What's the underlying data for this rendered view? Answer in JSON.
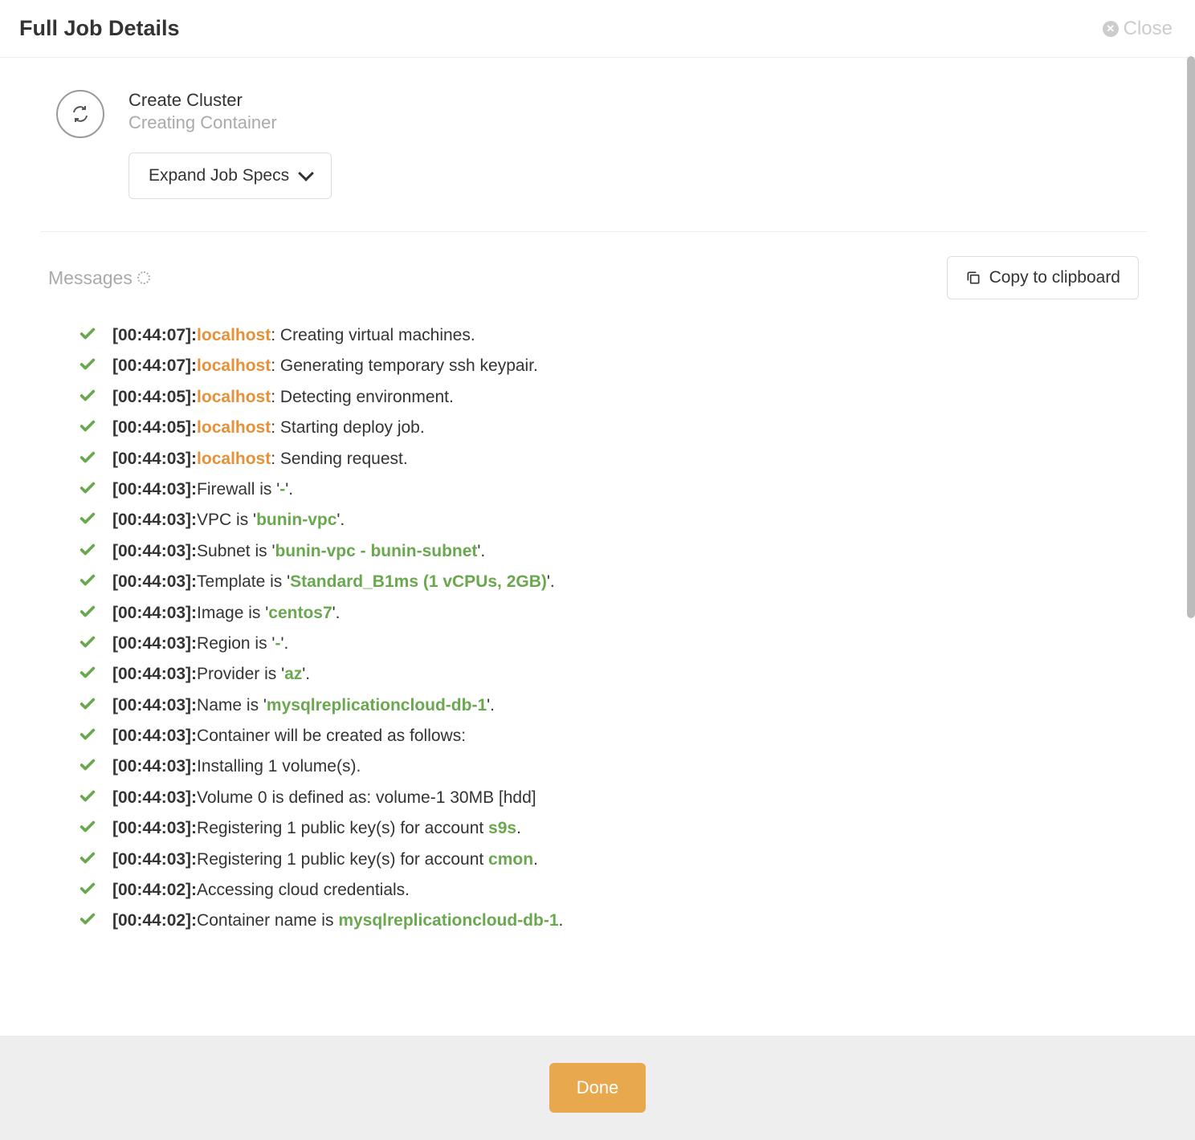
{
  "header": {
    "title": "Full Job Details",
    "close_label": "Close"
  },
  "job": {
    "name": "Create Cluster",
    "status": "Creating Container",
    "expand_label": "Expand Job Specs"
  },
  "messages_section": {
    "label": "Messages",
    "copy_label": "Copy to clipboard"
  },
  "footer": {
    "done_label": "Done"
  },
  "logs": [
    {
      "ts": "[00:44:07]:",
      "host": "localhost",
      "pre": ": ",
      "text": "Creating virtual machines."
    },
    {
      "ts": "[00:44:07]:",
      "host": "localhost",
      "pre": ": ",
      "text": "Generating temporary ssh keypair."
    },
    {
      "ts": "[00:44:05]:",
      "host": "localhost",
      "pre": ": ",
      "text": "Detecting environment."
    },
    {
      "ts": "[00:44:05]:",
      "host": "localhost",
      "pre": ": ",
      "text": "Starting deploy job."
    },
    {
      "ts": "[00:44:03]:",
      "host": "localhost",
      "pre": ": ",
      "text": "Sending request."
    },
    {
      "ts": "[00:44:03]:",
      "pre": "Firewall is '",
      "val": "-",
      "post": "'."
    },
    {
      "ts": "[00:44:03]:",
      "pre": "VPC is '",
      "val": "bunin-vpc",
      "post": "'."
    },
    {
      "ts": "[00:44:03]:",
      "pre": "Subnet is '",
      "val": "bunin-vpc - bunin-subnet",
      "post": "'."
    },
    {
      "ts": "[00:44:03]:",
      "pre": "Template is '",
      "val": "Standard_B1ms (1 vCPUs, 2GB)",
      "post": "'."
    },
    {
      "ts": "[00:44:03]:",
      "pre": "Image is '",
      "val": "centos7",
      "post": "'."
    },
    {
      "ts": "[00:44:03]:",
      "pre": "Region is '",
      "val": "-",
      "post": "'."
    },
    {
      "ts": "[00:44:03]:",
      "pre": "Provider is '",
      "val": "az",
      "post": "'."
    },
    {
      "ts": "[00:44:03]:",
      "pre": "Name is '",
      "val": "mysqlreplicationcloud-db-1",
      "post": "'."
    },
    {
      "ts": "[00:44:03]:",
      "text": "Container will be created as follows:"
    },
    {
      "ts": "[00:44:03]:",
      "text": "Installing 1 volume(s)."
    },
    {
      "ts": "[00:44:03]:",
      "text": "Volume 0 is defined as: volume-1 30MB [hdd]"
    },
    {
      "ts": "[00:44:03]:",
      "pre": "Registering 1 public key(s) for account ",
      "val": "s9s",
      "post": "."
    },
    {
      "ts": "[00:44:03]:",
      "pre": "Registering 1 public key(s) for account ",
      "val": "cmon",
      "post": "."
    },
    {
      "ts": "[00:44:02]:",
      "text": "Accessing cloud credentials."
    },
    {
      "ts": "[00:44:02]:",
      "pre": "Container name is ",
      "val": "mysqlreplicationcloud-db-1",
      "post": "."
    }
  ]
}
